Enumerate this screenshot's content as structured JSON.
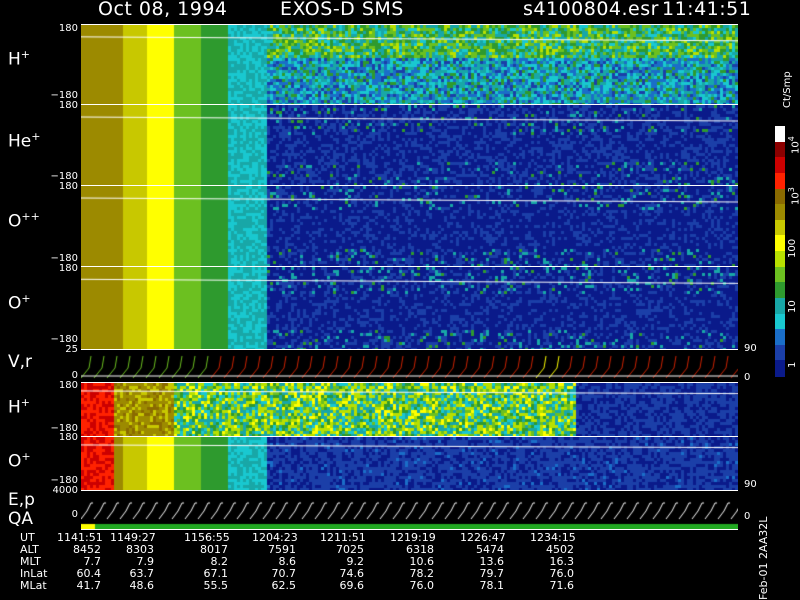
{
  "header": {
    "date": "Oct 08, 1994",
    "instrument": "EXOS-D SMS",
    "file": "s4100804.esr",
    "time": "11:41:51"
  },
  "panels": [
    {
      "id": "H1",
      "label": "H",
      "charge": "+",
      "top": "180",
      "bottom": "−180"
    },
    {
      "id": "He",
      "label": "He",
      "charge": "+",
      "top": "180",
      "bottom": "−180"
    },
    {
      "id": "O2",
      "label": "O",
      "charge": "++",
      "top": "180",
      "bottom": "−180"
    },
    {
      "id": "O1",
      "label": "O",
      "charge": "+",
      "top": "180",
      "bottom": "−180"
    },
    {
      "id": "Vr",
      "label": "V,r",
      "top": "25",
      "bottom": "0"
    },
    {
      "id": "H2",
      "label": "H",
      "charge": "+",
      "top": "180",
      "bottom": "−180"
    },
    {
      "id": "O3",
      "label": "O",
      "charge": "+",
      "top": "180",
      "bottom": "−180"
    },
    {
      "id": "Ep",
      "label": "E,p",
      "top": "4000",
      "bottom": "0"
    }
  ],
  "qa_label": "QA",
  "right_ticks": {
    "vr_top": "90",
    "vr_bottom": "0",
    "ep_top": "90",
    "ep_bottom": "0"
  },
  "colorbar": {
    "unit": "Ct/Smp",
    "labels": [
      {
        "text": "10",
        "sup": "4"
      },
      {
        "text": "10",
        "sup": "3"
      },
      {
        "text": "100"
      },
      {
        "text": "10"
      },
      {
        "text": "1"
      }
    ],
    "colors": [
      "#ffffff",
      "#8b0000",
      "#cc0000",
      "#ff2200",
      "#8a6a00",
      "#9c8a00",
      "#c8c800",
      "#ffff00",
      "#b8e000",
      "#6cc020",
      "#2e9a2e",
      "#18a7a7",
      "#19c8d0",
      "#1a6ec8",
      "#1b3fa8",
      "#0a1a8a"
    ]
  },
  "table": {
    "rows": [
      {
        "name": "UT",
        "values": [
          "1141:51",
          "1149:27",
          "1156:55",
          "1204:23",
          "1211:51",
          "1219:19",
          "1226:47",
          "1234:15"
        ]
      },
      {
        "name": "ALT",
        "values": [
          "8452",
          "8303",
          "8017",
          "7591",
          "7025",
          "6318",
          "5474",
          "4502"
        ]
      },
      {
        "name": "MLT",
        "values": [
          "7.7",
          "7.9",
          "8.2",
          "8.6",
          "9.2",
          "10.6",
          "13.6",
          "16.3"
        ]
      },
      {
        "name": "InLat",
        "values": [
          "60.4",
          "63.7",
          "67.1",
          "70.7",
          "74.6",
          "78.2",
          "79.7",
          "76.0"
        ]
      },
      {
        "name": "MLat",
        "values": [
          "41.7",
          "48.6",
          "55.5",
          "62.5",
          "69.6",
          "76.0",
          "78.1",
          "71.6"
        ]
      }
    ]
  },
  "footer_id": "Feb-01 2AA32L",
  "chart_data": {
    "type": "heatmap",
    "title": "Oct 08, 1994   EXOS-D SMS",
    "x_ticks": [
      "1141:51",
      "1149:27",
      "1156:55",
      "1204:23",
      "1211:51",
      "1219:19",
      "1226:47",
      "1234:15"
    ],
    "colorbar_ticks": [
      "10^4",
      "10^3",
      "100",
      "10",
      "1"
    ],
    "colorbar_unit": "Ct/Smp",
    "panels": [
      "H+",
      "He+",
      "O++",
      "O+",
      "V,r",
      "H+",
      "O+",
      "E,p"
    ],
    "panel_ylim": {
      "H+": [
        -180,
        180
      ],
      "He+": [
        -180,
        180
      ],
      "O++": [
        -180,
        180
      ],
      "O+": [
        -180,
        180
      ],
      "V,r": [
        0,
        25
      ],
      "E,p": [
        0,
        4000
      ]
    }
  }
}
